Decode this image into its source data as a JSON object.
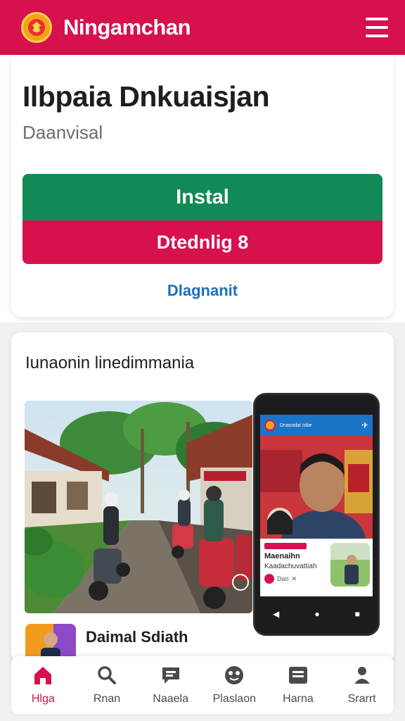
{
  "header": {
    "app_title": "Ningamchan",
    "logo_icon": "emblem-logo",
    "menu_icon": "hamburger-menu-icon"
  },
  "hero": {
    "title": "Ilbpaia Dnkuaisjan",
    "subtitle": "Daanvisal",
    "install_label": "Instal",
    "download_label": "Dtednlig 8",
    "details_link": "Dlagnanit"
  },
  "media": {
    "section_title": "Iunaonin linedimmania",
    "phone_screen": {
      "topbar_title": "Dnasodat Iobe",
      "news_title": "Maenaihn",
      "news_sub": "Kaadachuvattiah",
      "news_meta": "Dao"
    },
    "profile": {
      "name": "Daimal Sdiath"
    }
  },
  "bottom_nav": [
    {
      "label": "Hlga",
      "icon": "home-icon",
      "active": true
    },
    {
      "label": "Rnan",
      "icon": "search-icon",
      "active": false
    },
    {
      "label": "Naaela",
      "icon": "chat-icon",
      "active": false
    },
    {
      "label": "Plaslaon",
      "icon": "globe-icon",
      "active": false
    },
    {
      "label": "Harna",
      "icon": "list-icon",
      "active": false
    },
    {
      "label": "Srarrt",
      "icon": "person-icon",
      "active": false
    }
  ],
  "colors": {
    "brand_red": "#d6114e",
    "install_green": "#128a55",
    "link_blue": "#1a6fc0"
  }
}
